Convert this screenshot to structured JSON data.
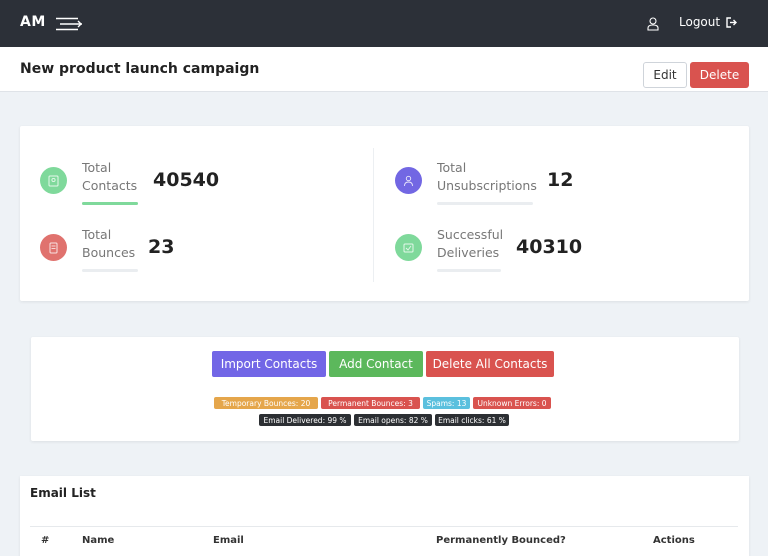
{
  "header": {
    "brand": "AM",
    "logout_label": "Logout"
  },
  "page": {
    "title": "New product launch campaign",
    "edit_label": "Edit",
    "delete_label": "Delete"
  },
  "stats": [
    {
      "label_line1": "Total",
      "label_line2": "Contacts",
      "value": "40540",
      "color": "#7fd99b",
      "bar_color": "#7fd99b",
      "bar_level": 1.0,
      "icon": "contacts-icon"
    },
    {
      "label_line1": "Total",
      "label_line2": "Bounces",
      "value": "23",
      "color": "#e0726e",
      "bar_color": "#eaedf0",
      "bar_level": 0.0,
      "icon": "bounces-icon"
    },
    {
      "label_line1": "Total",
      "label_line2": "Unsubscriptions",
      "value": "12",
      "color": "#7267e3",
      "bar_color": "#eaedf0",
      "bar_level": 0.0,
      "icon": "user-icon"
    },
    {
      "label_line1": "Successful",
      "label_line2": "Deliveries",
      "value": "40310",
      "color": "#7fd99b",
      "bar_color": "#eaedf0",
      "bar_level": 0.0,
      "icon": "deliveries-icon"
    }
  ],
  "actions": {
    "import_label": "Import Contacts",
    "add_label": "Add Contact",
    "delete_all_label": "Delete All Contacts",
    "import_color": "#7266e6",
    "add_color": "#5cb85c",
    "delete_all_color": "#d9534f"
  },
  "badges": {
    "temporary_bounces": "Temporary Bounces: 20",
    "permanent_bounces": "Permanent Bounces: 3",
    "spams": "Spams: 13",
    "unknown_errors": "Unknown Errors: 0",
    "email_delivered": "Email Delivered: 99 %",
    "email_opens": "Email opens: 82 %",
    "email_clicks": "Email clicks: 61 %"
  },
  "email_list": {
    "title": "Email List",
    "columns": [
      "#",
      "Name",
      "Email",
      "Permanently Bounced?",
      "Actions"
    ]
  }
}
